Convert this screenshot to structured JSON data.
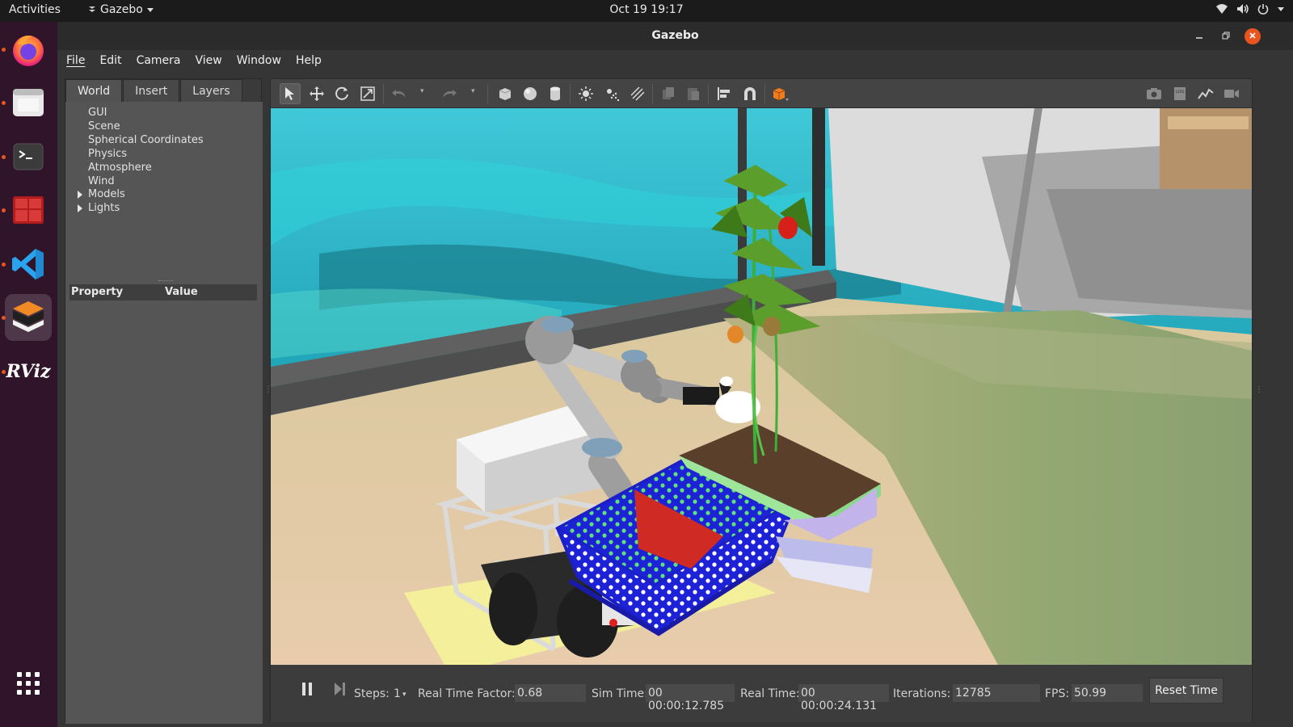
{
  "topbar": {
    "activities": "Activities",
    "app_menu": "Gazebo",
    "clock": "Oct 19  19:17",
    "tray_icons": [
      "network-icon",
      "volume-icon",
      "power-icon",
      "chevron-down-icon"
    ]
  },
  "dock": {
    "items": [
      {
        "name": "firefox",
        "label": "Firefox",
        "running": true
      },
      {
        "name": "files",
        "label": "Files",
        "running": true
      },
      {
        "name": "terminal",
        "label": "Terminal",
        "running": true
      },
      {
        "name": "terminator",
        "label": "Terminator",
        "running": true
      },
      {
        "name": "vscode",
        "label": "Visual Studio Code",
        "running": true
      },
      {
        "name": "gazebo",
        "label": "Gazebo",
        "running": true,
        "active": true
      },
      {
        "name": "rviz",
        "label": "RViz",
        "running": true
      }
    ],
    "rviz_text": "RViz",
    "apps_grid": "show-applications"
  },
  "window": {
    "title": "Gazebo",
    "menu": [
      "File",
      "Edit",
      "Camera",
      "View",
      "Window",
      "Help"
    ]
  },
  "left_panel": {
    "tabs": [
      "World",
      "Insert",
      "Layers"
    ],
    "selected_tab": "World",
    "tree": [
      {
        "label": "GUI",
        "expandable": false
      },
      {
        "label": "Scene",
        "expandable": false
      },
      {
        "label": "Spherical Coordinates",
        "expandable": false
      },
      {
        "label": "Physics",
        "expandable": false
      },
      {
        "label": "Atmosphere",
        "expandable": false
      },
      {
        "label": "Wind",
        "expandable": false
      },
      {
        "label": "Models",
        "expandable": true
      },
      {
        "label": "Lights",
        "expandable": true
      }
    ],
    "property_header": "Property",
    "value_header": "Value"
  },
  "toolbar": {
    "tools": [
      "select-mode",
      "translate-mode",
      "rotate-mode",
      "scale-mode",
      "undo",
      "redo",
      "box",
      "sphere",
      "cylinder",
      "point-light",
      "spot-light",
      "directional-light",
      "copy",
      "paste",
      "align",
      "snap",
      "change-view"
    ],
    "right_tools": [
      "screenshot",
      "log",
      "plot",
      "record-video"
    ]
  },
  "status": {
    "steps_label": "Steps:",
    "steps_value": "1",
    "rtf_label": "Real Time Factor:",
    "rtf_value": "0.68",
    "sim_time_label": "Sim Time:",
    "sim_time_value": "00 00:00:12.785",
    "real_time_label": "Real Time:",
    "real_time_value": "00 00:00:24.131",
    "iterations_label": "Iterations:",
    "iterations_value": "12785",
    "fps_label": "FPS:",
    "fps_value": "50.99",
    "reset_label": "Reset Time"
  },
  "colors": {
    "ubuntu_orange": "#e95420",
    "dock_bg": "#30152a",
    "basket_blue": "#1b22d8",
    "pot_green": "#9ee69a",
    "pepper_red": "#d8201a"
  }
}
